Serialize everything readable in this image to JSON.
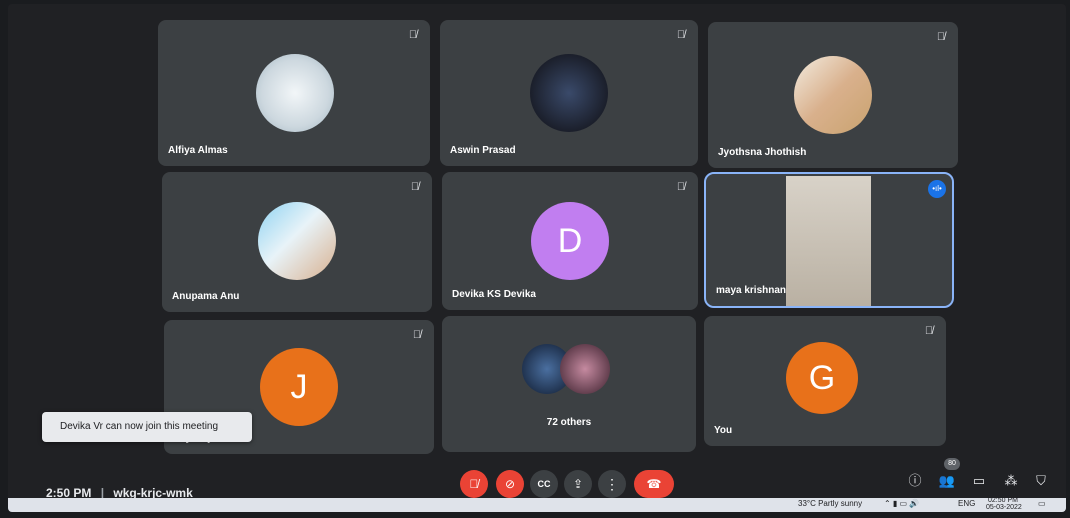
{
  "toast": {
    "text": "Devika Vr can now join this meeting"
  },
  "participants": [
    {
      "name": "Alfiya Almas"
    },
    {
      "name": "Aswin Prasad"
    },
    {
      "name": "Jyothsna Jhothish"
    },
    {
      "name": "Anupama Anu"
    },
    {
      "name": "Devika KS Devika",
      "initial": "D"
    },
    {
      "name": "maya krishnan"
    },
    {
      "name": "Joyal kj",
      "initial": "J"
    },
    {
      "name": "72 others"
    },
    {
      "name": "You",
      "initial": "G"
    }
  ],
  "colors": {
    "purple": "#c17ef0",
    "orange": "#e8711a",
    "red": "#ea4335",
    "blue": "#1a73e8"
  },
  "meeting": {
    "time": "2:50 PM",
    "separator": "|",
    "code": "wkg-krjc-wmk"
  },
  "controls": {
    "mic_icon": "mic-off-icon",
    "cam_icon": "videocam-off-icon",
    "cc_label": "CC",
    "present_icon": "present-icon",
    "more_icon": "more-vert-icon",
    "end_icon": "call-end-icon"
  },
  "right_icons": {
    "people_count": "80"
  },
  "taskbar": {
    "weather": "33°C Partly sunny",
    "lang": "ENG",
    "time": "02:50 PM",
    "date": "05-03-2022"
  }
}
